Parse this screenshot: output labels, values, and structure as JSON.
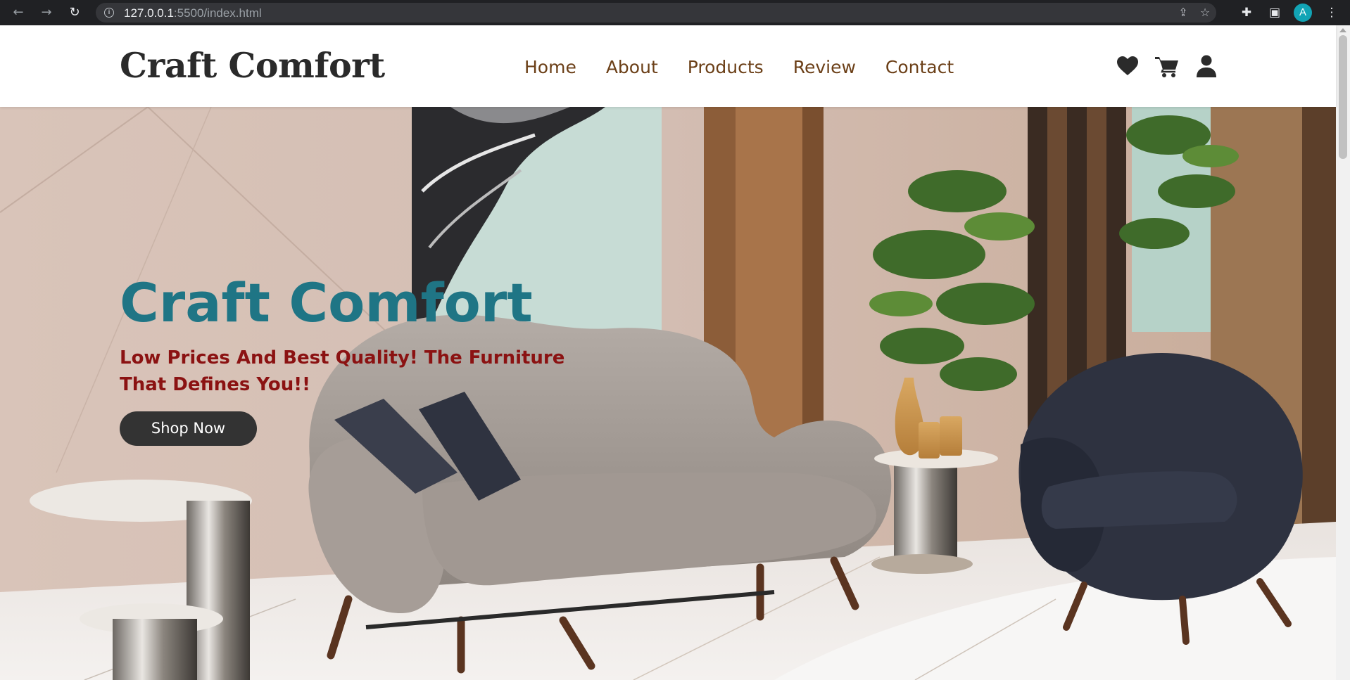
{
  "browser": {
    "url_host": "127.0.0.1",
    "url_path": ":5500/index.html",
    "profile_initial": "A"
  },
  "header": {
    "logo": "Craft Comfort",
    "nav": [
      "Home",
      "About",
      "Products",
      "Review",
      "Contact"
    ],
    "icons": [
      "heart-icon",
      "cart-icon",
      "user-icon"
    ]
  },
  "hero": {
    "title": "Craft Comfort",
    "subtitle": "Low Prices And Best Quality! The Furniture That Defines You!!",
    "button": "Shop Now"
  },
  "colors": {
    "logo": "#2a2a2a",
    "nav_link": "#6b3f17",
    "hero_title": "#1f7585",
    "hero_subtitle": "#8b1212",
    "button_bg": "#333333"
  }
}
